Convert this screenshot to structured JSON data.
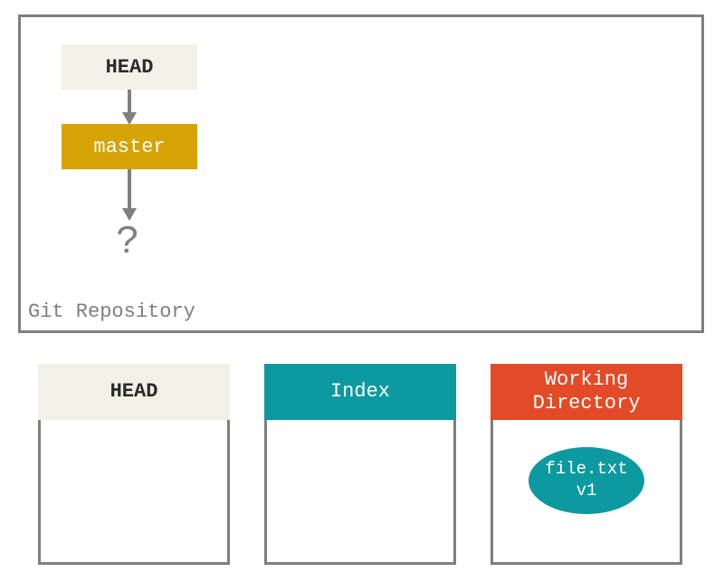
{
  "repo": {
    "label": "Git Repository",
    "head_label": "HEAD",
    "master_label": "master",
    "question": "?"
  },
  "columns": {
    "head": "HEAD",
    "index": "Index",
    "working_directory": "Working\nDirectory"
  },
  "file": {
    "name": "file.txt",
    "version": "v1"
  }
}
